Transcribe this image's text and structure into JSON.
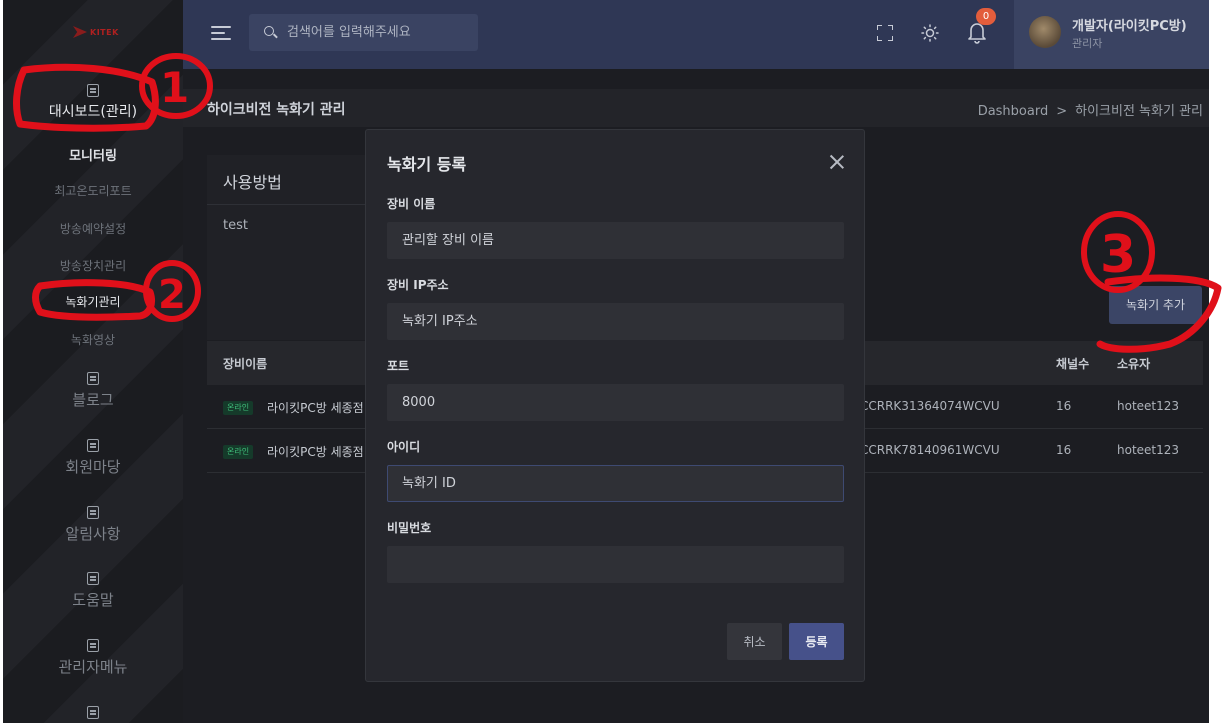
{
  "sidebar": {
    "logo_text": "KITEK",
    "dashboard_label": "대시보드(관리)",
    "sub_items": [
      "모니터링",
      "최고온도리포트",
      "방송예약설정",
      "방송장치관리",
      "녹화기관리",
      "녹화영상"
    ],
    "sections": [
      "블로그",
      "회원마당",
      "알림사항",
      "도움말",
      "관리자메뉴"
    ]
  },
  "topbar": {
    "search_placeholder": "검색어를 입력해주세요",
    "notification_count": "0",
    "user_name": "개발자(라이킷PC방)",
    "user_role": "관리자"
  },
  "page": {
    "title": "하이크비전 녹화기 관리",
    "breadcrumb": [
      "Dashboard",
      "하이크비전 녹화기 관리"
    ],
    "breadcrumb_sep": ">",
    "usage_title": "사용방법",
    "usage_text": "test",
    "add_button": "녹화기 추가"
  },
  "table": {
    "headers": {
      "name": "장비이름",
      "channels": "채널수",
      "owner": "소유자"
    },
    "rows": [
      {
        "status": "온라인",
        "name": "라이킷PC방 세종점",
        "serial": "CCRRK31364074WCVU",
        "channels": "16",
        "owner": "hoteet123"
      },
      {
        "status": "온라인",
        "name": "라이킷PC방 세종점",
        "serial": "CCRRK78140961WCVU",
        "channels": "16",
        "owner": "hoteet123"
      }
    ]
  },
  "modal": {
    "title": "녹화기 등록",
    "fields": [
      {
        "label": "장비 이름",
        "placeholder": "관리할 장비 이름",
        "value": ""
      },
      {
        "label": "장비 IP주소",
        "placeholder": "녹화기 IP주소",
        "value": ""
      },
      {
        "label": "포트",
        "placeholder": "",
        "value": "8000"
      },
      {
        "label": "아이디",
        "placeholder": "녹화기 ID",
        "value": ""
      },
      {
        "label": "비밀번호",
        "placeholder": "",
        "value": ""
      }
    ],
    "cancel_label": "취소",
    "submit_label": "등록"
  },
  "annotations": [
    "1",
    "2",
    "3"
  ],
  "colors": {
    "topbar": "#2f3755",
    "primary_button": "#46518a",
    "annotation_red": "#e0101a",
    "online": "#3fbf7a"
  }
}
